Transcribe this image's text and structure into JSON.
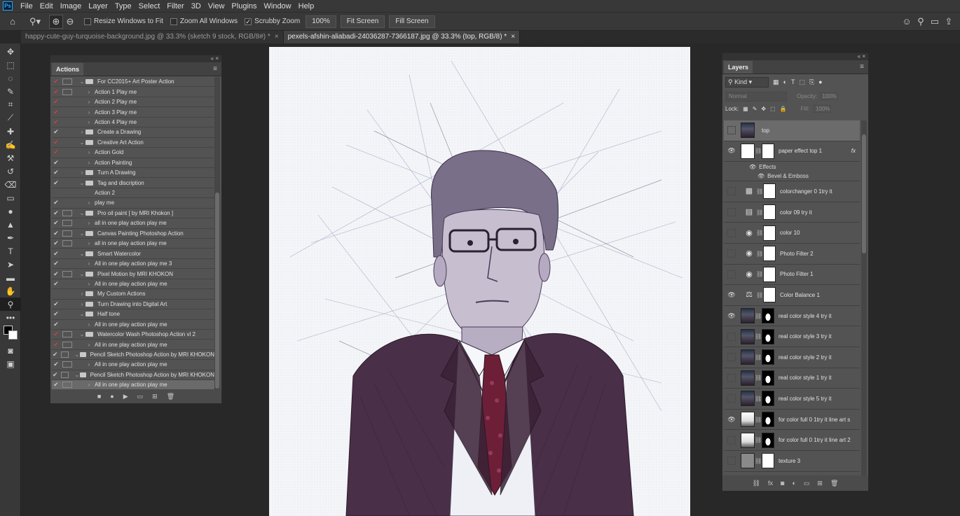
{
  "menu": {
    "app_logo": "Ps",
    "items": [
      "File",
      "Edit",
      "Image",
      "Layer",
      "Type",
      "Select",
      "Filter",
      "3D",
      "View",
      "Plugins",
      "Window",
      "Help"
    ]
  },
  "options": {
    "resize_windows": "Resize Windows to Fit",
    "zoom_all": "Zoom All Windows",
    "scrubby_zoom": "Scrubby Zoom",
    "zoom_value": "100%",
    "fit_screen": "Fit Screen",
    "fill_screen": "Fill Screen"
  },
  "tabs": [
    {
      "label": "happy-cute-guy-turquoise-background.jpg @ 33.3% (sketch 9 stock, RGB/8#) *",
      "close": "×"
    },
    {
      "label": "pexels-afshin-aliabadi-24036287-7366187.jpg @ 33.3% (top, RGB/8) *",
      "close": "×"
    }
  ],
  "actions_panel": {
    "title": "Actions",
    "rows": [
      {
        "check": "red",
        "dlg": true,
        "indent": 1,
        "tw": "⌄",
        "folder": true,
        "label": "For CC2015+ Art Poster Action"
      },
      {
        "check": "red",
        "dlg": true,
        "indent": 2,
        "tw": "›",
        "folder": false,
        "label": "Action 1 Play me"
      },
      {
        "check": "red",
        "dlg": false,
        "indent": 2,
        "tw": "›",
        "folder": false,
        "label": "Action 2 Play me"
      },
      {
        "check": "red",
        "dlg": false,
        "indent": 2,
        "tw": "›",
        "folder": false,
        "label": "Action 3 Play me"
      },
      {
        "check": "red",
        "dlg": false,
        "indent": 2,
        "tw": "›",
        "folder": false,
        "label": "Action 4 Play me"
      },
      {
        "check": "white",
        "dlg": false,
        "indent": 1,
        "tw": "›",
        "folder": true,
        "label": "Create a Drawing"
      },
      {
        "check": "red",
        "dlg": false,
        "indent": 1,
        "tw": "⌄",
        "folder": true,
        "label": "Creative Art Action"
      },
      {
        "check": "red",
        "dlg": false,
        "indent": 2,
        "tw": "›",
        "folder": false,
        "label": "Action Gold"
      },
      {
        "check": "white",
        "dlg": false,
        "indent": 2,
        "tw": "›",
        "folder": false,
        "label": "Action Painting"
      },
      {
        "check": "white",
        "dlg": false,
        "indent": 1,
        "tw": "›",
        "folder": true,
        "label": "Turn A Drawing"
      },
      {
        "check": "white",
        "dlg": false,
        "indent": 1,
        "tw": "⌄",
        "folder": true,
        "label": "Tag and discription"
      },
      {
        "check": "none",
        "dlg": false,
        "indent": 2,
        "tw": "",
        "folder": false,
        "label": "Action 2"
      },
      {
        "check": "white",
        "dlg": false,
        "indent": 2,
        "tw": "›",
        "folder": false,
        "label": "play me"
      },
      {
        "check": "white",
        "dlg": true,
        "indent": 1,
        "tw": "⌄",
        "folder": true,
        "label": "Pro oil paint [ by MRI Khokon ]"
      },
      {
        "check": "white",
        "dlg": true,
        "indent": 2,
        "tw": "›",
        "folder": false,
        "label": "all in one play action play me"
      },
      {
        "check": "white",
        "dlg": true,
        "indent": 1,
        "tw": "⌄",
        "folder": true,
        "label": "Canvas Painting Photoshop Action"
      },
      {
        "check": "white",
        "dlg": true,
        "indent": 2,
        "tw": "›",
        "folder": false,
        "label": "all in one play action play me"
      },
      {
        "check": "white",
        "dlg": false,
        "indent": 1,
        "tw": "⌄",
        "folder": true,
        "label": "Smart Watercolor"
      },
      {
        "check": "white",
        "dlg": false,
        "indent": 2,
        "tw": "›",
        "folder": false,
        "label": "All in one play action play me 3"
      },
      {
        "check": "white",
        "dlg": true,
        "indent": 1,
        "tw": "⌄",
        "folder": true,
        "label": "Pixel Motion by MRI KHOKON"
      },
      {
        "check": "white",
        "dlg": false,
        "indent": 2,
        "tw": "›",
        "folder": false,
        "label": "All in one play action play me"
      },
      {
        "check": "none",
        "dlg": false,
        "indent": 1,
        "tw": "›",
        "folder": true,
        "label": "My Custom Actions"
      },
      {
        "check": "white",
        "dlg": false,
        "indent": 1,
        "tw": "›",
        "folder": true,
        "label": "Turn Drawing into Digital Art"
      },
      {
        "check": "white",
        "dlg": false,
        "indent": 1,
        "tw": "⌄",
        "folder": true,
        "label": "Half tone"
      },
      {
        "check": "white",
        "dlg": false,
        "indent": 2,
        "tw": "›",
        "folder": false,
        "label": "All in one play action play me"
      },
      {
        "check": "red",
        "dlg": true,
        "indent": 1,
        "tw": "⌄",
        "folder": true,
        "label": "Watercolor Wash Photoshop Action vl 2"
      },
      {
        "check": "red",
        "dlg": true,
        "indent": 2,
        "tw": "›",
        "folder": false,
        "label": "All in one play action play me"
      },
      {
        "check": "white",
        "dlg": true,
        "indent": 1,
        "tw": "⌄",
        "folder": true,
        "label": "Pencil Sketch Photoshop Action by MRI KHOKON"
      },
      {
        "check": "white",
        "dlg": true,
        "indent": 2,
        "tw": "›",
        "folder": false,
        "label": "All in one play action play me"
      },
      {
        "check": "white",
        "dlg": true,
        "indent": 1,
        "tw": "⌄",
        "folder": true,
        "label": "Pencil Sketch Photoshop Action by MRI KHOKON"
      },
      {
        "check": "white",
        "dlg": true,
        "indent": 2,
        "tw": "›",
        "folder": false,
        "label": "All in one play action play me",
        "selected": true
      }
    ]
  },
  "layers_panel": {
    "title": "Layers",
    "kind": "Kind",
    "blend_mode": "Normal",
    "opacity_label": "Opacity:",
    "opacity_value": "100%",
    "lock_label": "Lock:",
    "fill_label": "Fill:",
    "fill_value": "100%",
    "effects_label": "Effects",
    "bevel_label": "Bevel & Emboss",
    "layers": [
      {
        "name": "top",
        "visible": false,
        "thumb": "photo",
        "mask": "none",
        "selected": true
      },
      {
        "name": "paper effect top 1",
        "visible": true,
        "thumb": "white",
        "mask": "white",
        "fx": true
      },
      {
        "name": "colorchanger 0 1try it",
        "visible": false,
        "thumb": "adj",
        "adj": "▦",
        "mask": "white"
      },
      {
        "name": "color 09 try it",
        "visible": false,
        "thumb": "adj",
        "adj": "▤",
        "mask": "white"
      },
      {
        "name": "color 10",
        "visible": false,
        "thumb": "adj",
        "adj": "◉",
        "mask": "white"
      },
      {
        "name": "Photo Filter 2",
        "visible": false,
        "thumb": "adj",
        "adj": "◉",
        "mask": "white"
      },
      {
        "name": "Photo Filter 1",
        "visible": false,
        "thumb": "adj",
        "adj": "◉",
        "mask": "white"
      },
      {
        "name": "Color Balance 1",
        "visible": true,
        "thumb": "adj",
        "adj": "⚖",
        "mask": "white"
      },
      {
        "name": "real color style 4 try it",
        "visible": true,
        "thumb": "photo",
        "mask": "black"
      },
      {
        "name": "real color style 3 try it",
        "visible": false,
        "thumb": "photo",
        "mask": "black"
      },
      {
        "name": "real color style 2 try it",
        "visible": false,
        "thumb": "photo",
        "mask": "black"
      },
      {
        "name": "real color style 1 try it",
        "visible": false,
        "thumb": "photo",
        "mask": "black"
      },
      {
        "name": "real color style 5 try it",
        "visible": false,
        "thumb": "photo",
        "mask": "black"
      },
      {
        "name": "for color full 0 1try it line art s",
        "visible": true,
        "thumb": "sketch",
        "mask": "black"
      },
      {
        "name": "for color full 0 1try it line art 2",
        "visible": false,
        "thumb": "sketch",
        "mask": "black"
      },
      {
        "name": "texture 3",
        "visible": false,
        "thumb": "gray",
        "mask": "white"
      }
    ]
  },
  "colors": {
    "accent_red": "#d04040",
    "panel_bg": "#535353",
    "app_bg": "#282828"
  }
}
